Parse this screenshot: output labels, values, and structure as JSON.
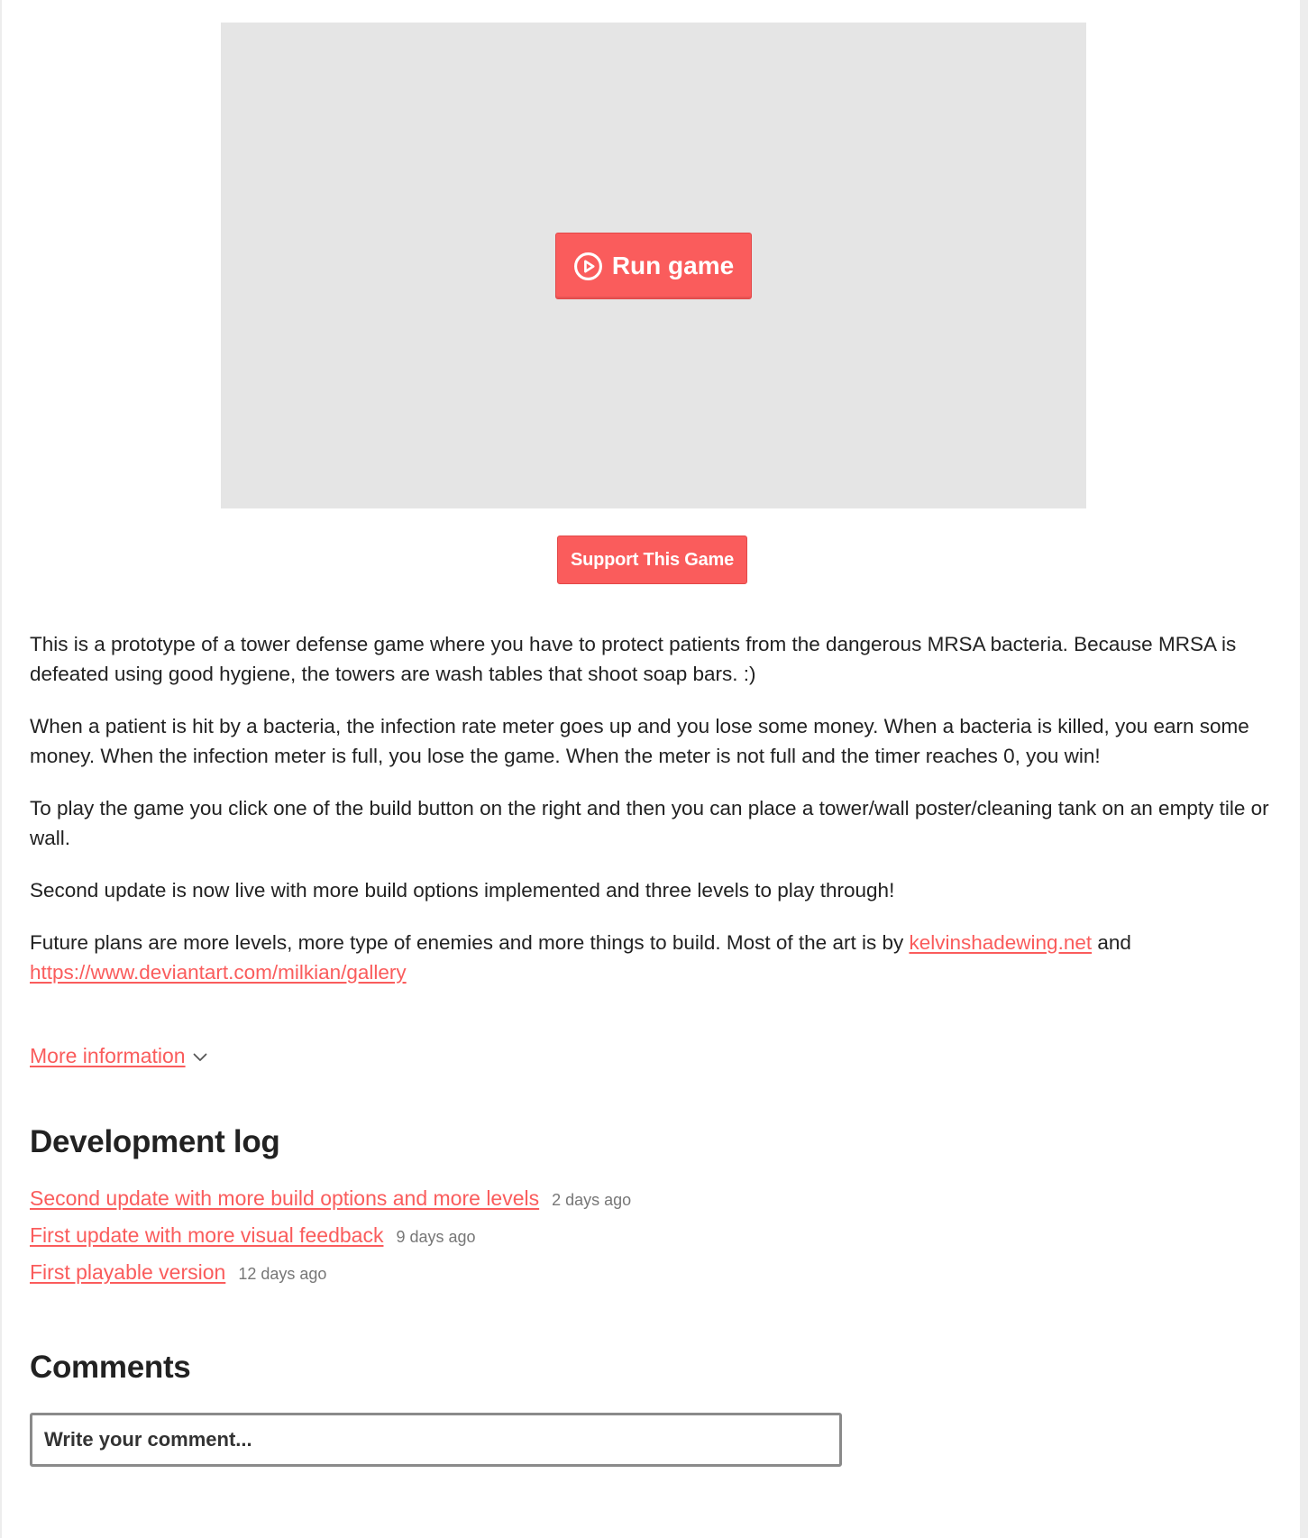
{
  "game": {
    "run_button_label": "Run game",
    "support_button_label": "Support This Game"
  },
  "description": {
    "paragraphs": [
      "This is a prototype of a tower defense game where you have to protect patients from the dangerous MRSA bacteria. Because MRSA is defeated using good hygiene, the towers are wash tables that shoot soap bars. :)",
      "When a patient is hit by a bacteria, the infection rate meter goes up and you lose some money. When a bacteria is killed, you earn some money. When the infection meter is full, you lose the game. When the meter is not full and the timer reaches 0, you win!",
      "To play the game you click one of the build button on the right and then you can place a tower/wall poster/cleaning tank on an empty tile or wall.",
      "Second update is now live with more build options implemented and three levels to play through!"
    ],
    "credits_prefix": "Future plans are more levels, more type of enemies and more things to build. Most of the art is by ",
    "credits_link_1": "kelvinshadewing.net",
    "credits_middle": " and ",
    "credits_link_2": "https://www.deviantart.com/milkian/gallery"
  },
  "more_info": {
    "label": "More information"
  },
  "devlog": {
    "title": "Development log",
    "entries": [
      {
        "title": "Second update with more build options and more levels",
        "date": "2 days ago"
      },
      {
        "title": "First update with more visual feedback",
        "date": "9 days ago"
      },
      {
        "title": "First playable version",
        "date": "12 days ago"
      }
    ]
  },
  "comments": {
    "title": "Comments",
    "placeholder": "Write your comment..."
  },
  "colors": {
    "accent": "#fa5c5c",
    "text": "#222222",
    "muted": "#777777",
    "game_frame_bg": "#e5e5e5"
  },
  "icons": {
    "run": "play-circle-icon",
    "expand": "chevron-down-icon"
  }
}
